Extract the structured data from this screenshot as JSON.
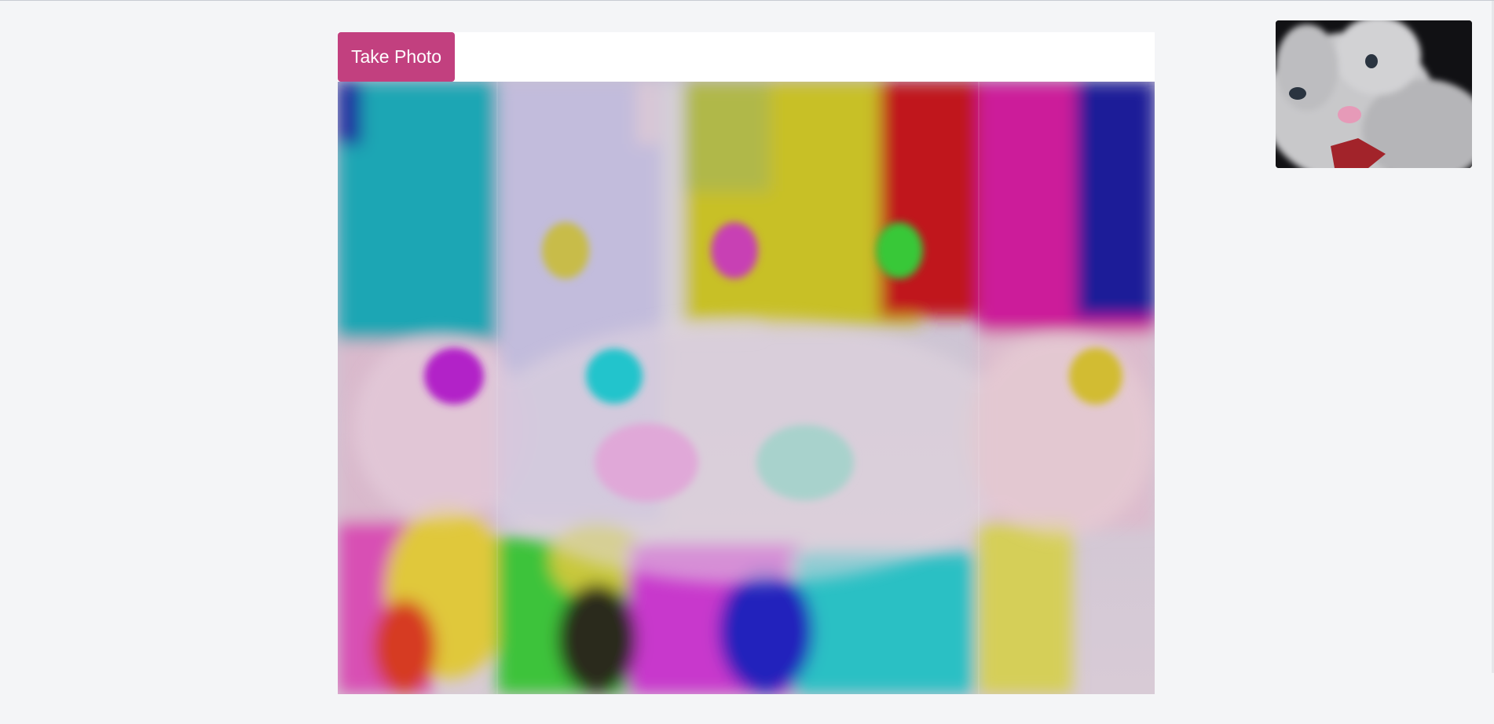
{
  "toolbar": {
    "take_photo_label": "Take Photo"
  },
  "effect_view": {
    "description_icon": "plush-bunny-rgb-split-effect-image"
  },
  "preview": {
    "description_icon": "plush-bunny-webcam-preview-image"
  },
  "colors": {
    "background": "#f4f5f7",
    "button": "#c2407f",
    "button_text": "#ffffff",
    "toolbar": "#ffffff"
  }
}
